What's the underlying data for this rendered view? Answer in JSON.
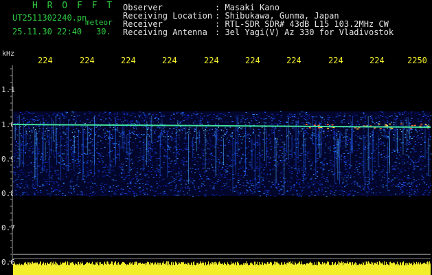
{
  "header": {
    "title": "H R O F F T",
    "filename": "UT2511302240.pn",
    "meteor_label": "meteor",
    "datetime": "25.11.30 22:40",
    "count": "30.",
    "info": [
      {
        "label": "Observer",
        "value": ": Masaki Kano"
      },
      {
        "label": "Receiving Location",
        "value": ": Shibukawa, Gunma, Japan"
      },
      {
        "label": "Receiver",
        "value": ": RTL-SDR SDR# 43dB L15 103.2MHz CW"
      },
      {
        "label": "Receiving Antenna",
        "value": ": 3el Yagi(V) Az 330 for Vladivostok"
      }
    ]
  },
  "yaxis": {
    "unit": "kHz",
    "ticks": [
      "1.1",
      "1.0",
      "0.9",
      "0.8",
      "0.7",
      "0.6"
    ]
  },
  "xaxis": {
    "ticks": [
      "224",
      "224",
      "224",
      "224",
      "224",
      "224",
      "224",
      "224",
      "224",
      "2250"
    ]
  },
  "colors": {
    "header_title": "#2ecc40",
    "header_text": "#e6e6e6",
    "time_labels": "#f2ee2a",
    "baseline": "#f2ee2a",
    "signal_line": "#40e0a0"
  }
}
